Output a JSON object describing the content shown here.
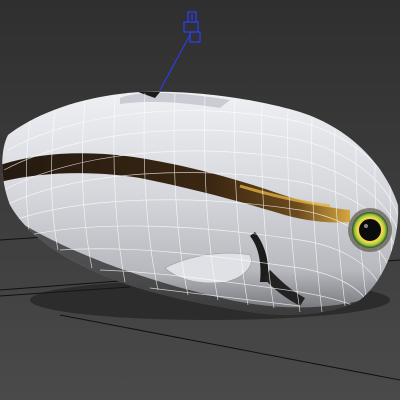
{
  "viewport": {
    "background_top": "#2f2f2f",
    "background_bottom": "#4a4a4a",
    "grid_color": "#111111"
  },
  "model": {
    "body_color": "#d9dbe0",
    "wire_color": "#ffffff",
    "stripe_dark": "#1b140c",
    "stripe_gold": "#e0b040",
    "eye_ring": "#f2d44a",
    "eye_green": "#8ccf3a",
    "shadow": "#1a1a1a"
  },
  "light_gizmo": {
    "icon": "light-bulb-icon",
    "color": "#2a3fff"
  }
}
